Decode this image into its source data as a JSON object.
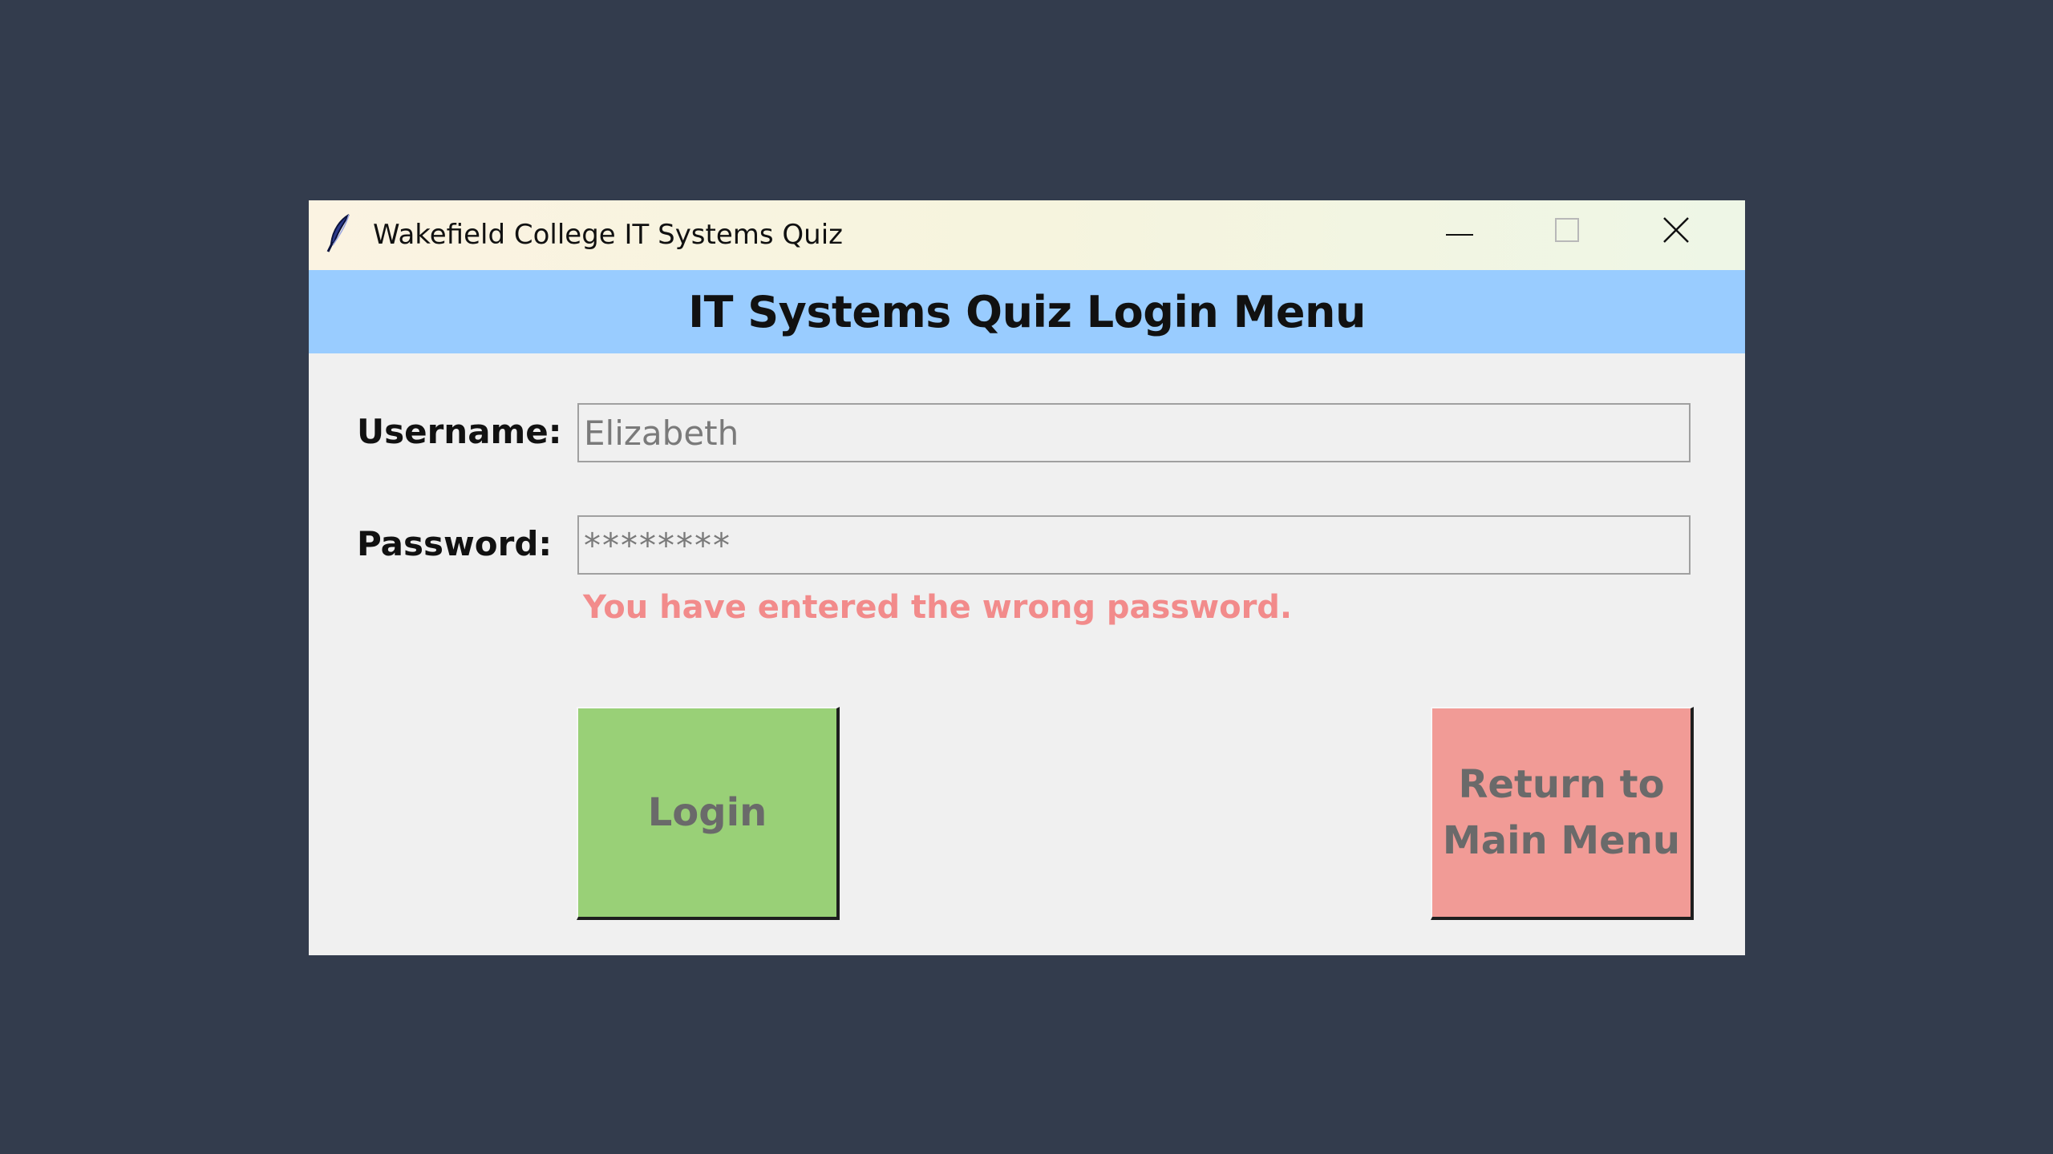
{
  "window": {
    "title": "Wakefield College IT Systems Quiz",
    "icon": "feather-icon",
    "controls": [
      "minimize-icon",
      "maximize-icon",
      "close-icon"
    ]
  },
  "header": {
    "title": "IT Systems Quiz Login Menu",
    "background": "#99ccff"
  },
  "form": {
    "username_label": "Username:",
    "username_value": "Elizabeth",
    "password_label": "Password:",
    "password_value": "********",
    "error_message": "You have entered the wrong password.",
    "error_color": "#f28b8b"
  },
  "buttons": {
    "login_label": "Login",
    "login_color": "#99d077",
    "return_label": "Return to Main Menu",
    "return_color": "#f19b96"
  }
}
